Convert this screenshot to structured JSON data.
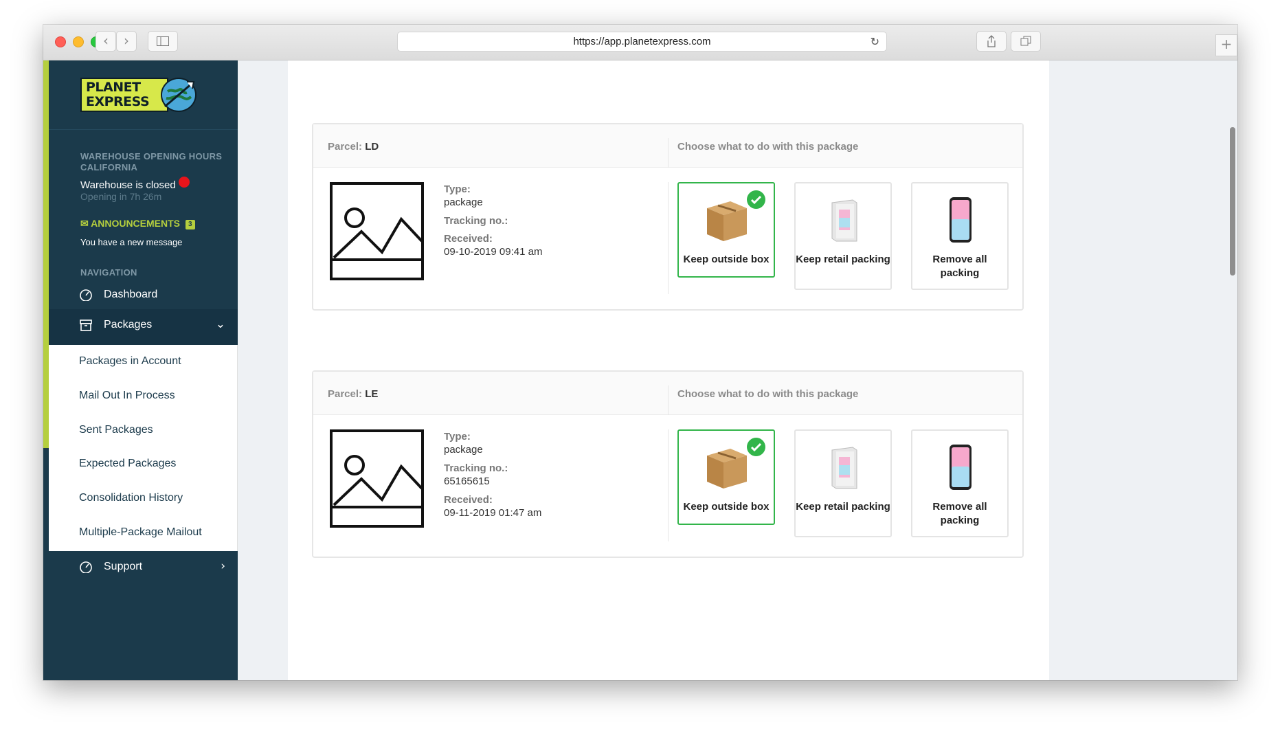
{
  "browser": {
    "url": "https://app.planetexpress.com"
  },
  "sidebar": {
    "logo_line1": "PLANET",
    "logo_line2": "EXPRESS",
    "hours_label_1": "WAREHOUSE OPENING HOURS",
    "hours_label_2": "CALIFORNIA",
    "warehouse_status": "Warehouse is closed",
    "opening_in": "Opening in 7h 26m",
    "announcements_label": "ANNOUNCEMENTS",
    "announcements_count": "3",
    "announcement_text": "You have a new message",
    "navigation_label": "NAVIGATION",
    "nav": {
      "dashboard": "Dashboard",
      "packages": "Packages",
      "support": "Support"
    },
    "subnav": [
      "Packages in Account",
      "Mail Out In Process",
      "Sent Packages",
      "Expected Packages",
      "Consolidation History",
      "Multiple-Package Mailout"
    ]
  },
  "parcels": [
    {
      "title_prefix": "Parcel:",
      "id": "LD",
      "choose_label": "Choose what to do with this package",
      "type_label": "Type:",
      "type": "package",
      "tracking_label": "Tracking no.:",
      "tracking": "",
      "received_label": "Received:",
      "received": "09-10-2019 09:41 am",
      "options": [
        "Keep outside box",
        "Keep retail packing",
        "Remove all packing"
      ],
      "selected_option": "Keep outside box"
    },
    {
      "title_prefix": "Parcel:",
      "id": "LE",
      "choose_label": "Choose what to do with this package",
      "type_label": "Type:",
      "type": "package",
      "tracking_label": "Tracking no.:",
      "tracking": "65165615",
      "received_label": "Received:",
      "received": "09-11-2019 01:47 am",
      "options": [
        "Keep outside box",
        "Keep retail packing",
        "Remove all packing"
      ],
      "selected_option": "Keep outside box"
    }
  ],
  "colors": {
    "sidebar_bg": "#1b3a4b",
    "accent": "#b5cf3e",
    "selected_border": "#32b54a",
    "status_red": "#e8141b"
  },
  "icons": [
    "back-icon",
    "forward-icon",
    "sidebar-toggle-icon",
    "reload-icon",
    "share-icon",
    "tabs-icon",
    "new-tab-icon",
    "dashboard-icon",
    "box-icon",
    "chevron-down-icon",
    "chevron-right-icon",
    "envelope-icon",
    "image-placeholder-icon",
    "checkmark-icon",
    "cardboard-box-icon",
    "retail-box-icon",
    "phone-icon"
  ]
}
